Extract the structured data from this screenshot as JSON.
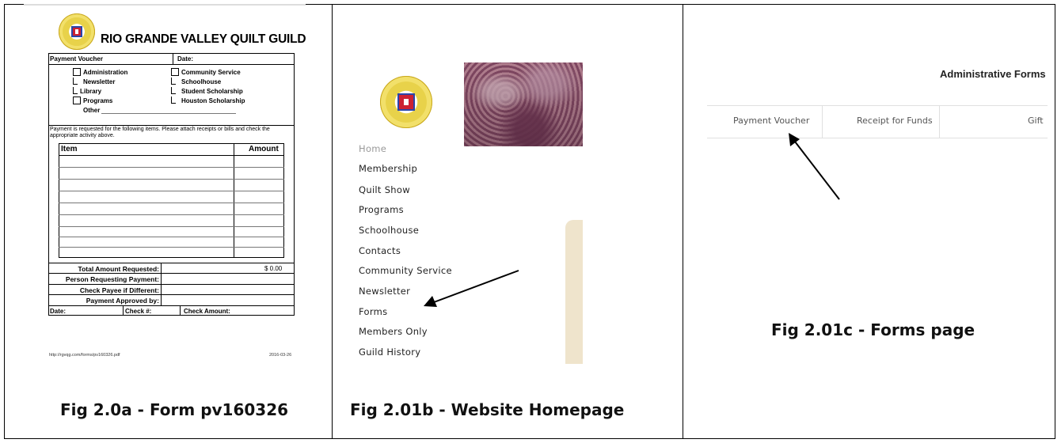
{
  "panel_a": {
    "guild_title": "RIO GRANDE VALLEY QUILT GUILD",
    "form": {
      "payment_voucher": "Payment Voucher",
      "date_label": "Date:",
      "categories_left": [
        "Administration",
        "Newsletter",
        "Library",
        "Programs",
        "Other"
      ],
      "categories_right": [
        "Community Service",
        "Schoolhouse",
        "Student Scholarship",
        "Houston Scholarship"
      ],
      "request_text_1": "Payment is requested for the following items.  Please attach receipts or bills and check the",
      "request_text_2": "appropriate activity above.",
      "item_header": "Item",
      "amount_header": "Amount",
      "total_label": "Total Amount Requested:",
      "total_value": "$ 0.00",
      "person_label": "Person Requesting Payment:",
      "payee_label": "Check Payee if Different:",
      "approved_label": "Payment Approved by:",
      "footer_date": "Date:",
      "footer_check": "Check #:",
      "footer_amount": "Check Amount:"
    },
    "pdf_url": "http://rgvqg.com/forms/pv160326.pdf",
    "pdf_date": "2016-03-26",
    "caption": "Fig 2.0a - Form pv160326"
  },
  "panel_b": {
    "nav_items": [
      "Home",
      "Membership",
      "Quilt Show",
      "Programs",
      "Schoolhouse",
      "Contacts",
      "Community Service",
      "Newsletter",
      "Forms",
      "Members Only",
      "Guild History"
    ],
    "caption": "Fig 2.01b -   Website Homepage"
  },
  "panel_c": {
    "heading": "Administrative Forms",
    "tabs": [
      "Payment Voucher",
      "Receipt for Funds",
      "Gift"
    ],
    "caption": "Fig 2.01c -  Forms page"
  }
}
